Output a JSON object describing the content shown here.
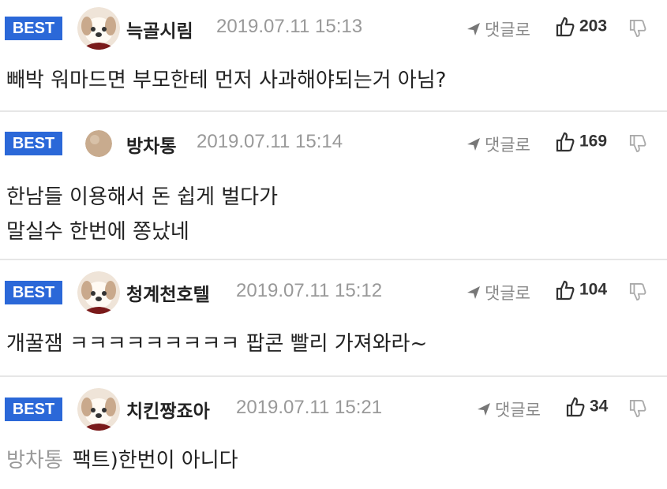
{
  "comments": [
    {
      "badge": "BEST",
      "nickname": "늑골시림",
      "datetime": "2019.07.11 15:13",
      "reply_label": "댓글로",
      "likes": "203",
      "lines": [
        "빼박 워마드면 부모한테 먼저 사과해야되는거 아님?"
      ]
    },
    {
      "badge": "BEST",
      "nickname": "방차통",
      "datetime": "2019.07.11 15:14",
      "reply_label": "댓글로",
      "likes": "169",
      "lines": [
        "한남들 이용해서 돈 쉽게 벌다가",
        "말실수 한번에 쫑났네"
      ]
    },
    {
      "badge": "BEST",
      "nickname": "청계천호텔",
      "datetime": "2019.07.11 15:12",
      "reply_label": "댓글로",
      "likes": "104",
      "lines": [
        "개꿀잼 ㅋㅋㅋㅋㅋㅋㅋㅋㅋ 팝콘 빨리 가져와라~"
      ]
    },
    {
      "badge": "BEST",
      "nickname": "치킨짱죠아",
      "datetime": "2019.07.11 15:21",
      "reply_label": "댓글로",
      "likes": "34",
      "mention": "방차통",
      "lines": [
        "팩트)한번이 아니다"
      ]
    }
  ],
  "colors": {
    "badge": "#2b68d8",
    "date": "#999999",
    "divider": "#e6e6e6"
  },
  "icons": {
    "avatar": "puppy-avatar-icon",
    "avatar_alt": "plain-avatar-icon",
    "reply": "reply-arrow-icon",
    "like": "thumbs-up-icon",
    "dislike": "thumbs-down-icon"
  }
}
